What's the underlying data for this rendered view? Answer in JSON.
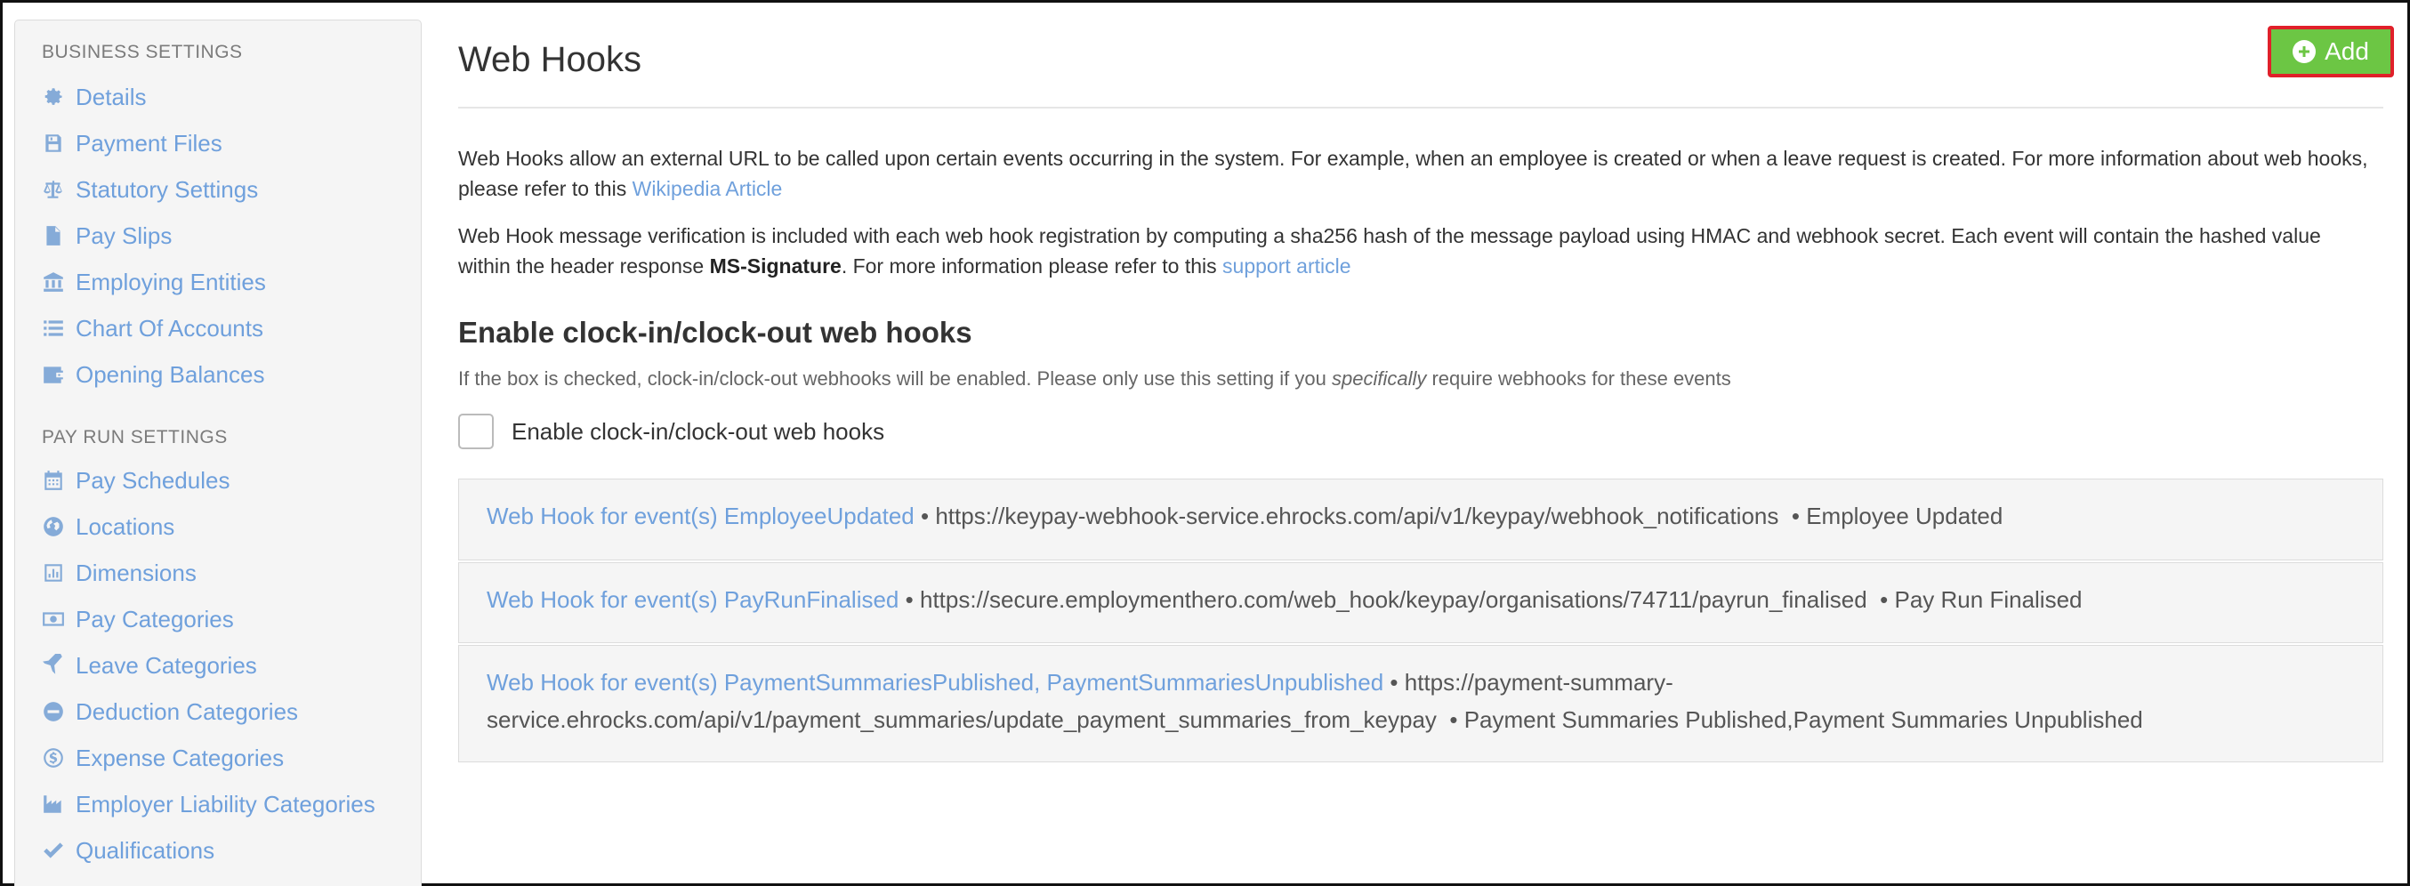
{
  "sidebar": {
    "business_settings_title": "BUSINESS SETTINGS",
    "business_items": [
      {
        "label": "Details",
        "icon": "gear-icon"
      },
      {
        "label": "Payment Files",
        "icon": "floppy-disk-icon"
      },
      {
        "label": "Statutory Settings",
        "icon": "scales-icon"
      },
      {
        "label": "Pay Slips",
        "icon": "file-icon"
      },
      {
        "label": "Employing Entities",
        "icon": "bank-icon"
      },
      {
        "label": "Chart Of Accounts",
        "icon": "list-icon"
      },
      {
        "label": "Opening Balances",
        "icon": "wallet-icon"
      }
    ],
    "pay_run_settings_title": "PAY RUN SETTINGS",
    "pay_run_items": [
      {
        "label": "Pay Schedules",
        "icon": "calendar-icon"
      },
      {
        "label": "Locations",
        "icon": "globe-icon"
      },
      {
        "label": "Dimensions",
        "icon": "bar-chart-icon"
      },
      {
        "label": "Pay Categories",
        "icon": "money-icon"
      },
      {
        "label": "Leave Categories",
        "icon": "plane-icon"
      },
      {
        "label": "Deduction Categories",
        "icon": "minus-circle-icon"
      },
      {
        "label": "Expense Categories",
        "icon": "dollar-circle-icon"
      },
      {
        "label": "Employer Liability Categories",
        "icon": "industry-icon"
      },
      {
        "label": "Qualifications",
        "icon": "check-icon"
      }
    ]
  },
  "main": {
    "title": "Web Hooks",
    "add_label": "Add",
    "intro_1_text": "Web Hooks allow an external URL to be called upon certain events occurring in the system. For example, when an employee is created or when a leave request is created. For more information about web hooks, please refer to this ",
    "intro_1_link": "Wikipedia Article",
    "intro_2_text_a": "Web Hook message verification is included with each web hook registration by computing a sha256 hash of the message payload using HMAC and webhook secret. Each event will contain the hashed value within the header response ",
    "intro_2_bold": "MS-Signature",
    "intro_2_text_b": ". For more information please refer to this ",
    "intro_2_link": "support article",
    "clock_heading": "Enable clock-in/clock-out web hooks",
    "clock_hint_a": "If the box is checked, clock-in/clock-out webhooks will be enabled. Please only use this setting if you ",
    "clock_hint_em": "specifically",
    "clock_hint_b": " require webhooks for these events",
    "clock_checkbox_label": "Enable clock-in/clock-out web hooks",
    "clock_checked": false,
    "hooks": [
      {
        "title": "Web Hook for event(s) EmployeeUpdated",
        "url": "https://keypay-webhook-service.ehrocks.com/api/v1/keypay/webhook_notifications",
        "events": "Employee Updated"
      },
      {
        "title": "Web Hook for event(s) PayRunFinalised",
        "url": "https://secure.employmenthero.com/web_hook/keypay/organisations/74711/payrun_finalised",
        "events": "Pay Run Finalised"
      },
      {
        "title": "Web Hook for event(s) PaymentSummariesPublished, PaymentSummariesUnpublished",
        "url": "https://payment-summary-service.ehrocks.com/api/v1/payment_summaries/update_payment_summaries_from_keypay",
        "events": "Payment Summaries Published,Payment Summaries Unpublished"
      }
    ]
  },
  "colors": {
    "link": "#6fa0dc",
    "add_button": "#6cc644",
    "add_button_border": "#e0202a",
    "sidebar_bg": "#f5f5f5"
  }
}
